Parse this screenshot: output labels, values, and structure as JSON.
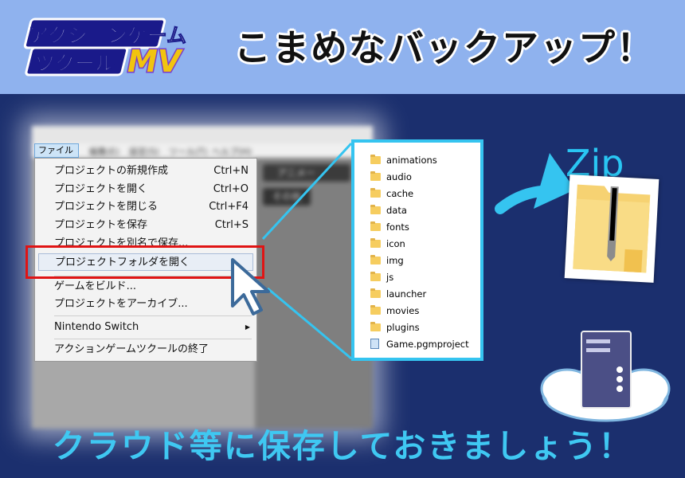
{
  "header": {
    "logo_line1": "アクションゲーム",
    "logo_line2": "ツクール",
    "logo_mv": "MV",
    "headline": "こまめなバックアップ！"
  },
  "app": {
    "menubar": [
      "ファイル(F)",
      "編集(E)",
      "設定(S)",
      "ツール(T)",
      "ヘルプ(H)"
    ],
    "canvas_button1": "アニメー",
    "canvas_button2": "その他"
  },
  "file_menu": {
    "items": [
      {
        "label": "プロジェクトの新規作成",
        "shortcut": "Ctrl+N"
      },
      {
        "label": "プロジェクトを開く",
        "shortcut": "Ctrl+O"
      },
      {
        "label": "プロジェクトを閉じる",
        "shortcut": "Ctrl+F4"
      },
      {
        "label": "プロジェクトを保存",
        "shortcut": "Ctrl+S"
      },
      {
        "label": "プロジェクトを別名で保存...",
        "shortcut": ""
      },
      {
        "label": "プロジェクトフォルダを開く",
        "shortcut": ""
      },
      {
        "label": "ゲームをビルド...",
        "shortcut": ""
      },
      {
        "label": "プロジェクトをアーカイブ...",
        "shortcut": ""
      },
      {
        "label": "Nintendo Switch",
        "shortcut": ""
      },
      {
        "label": "アクションゲームツクールの終了",
        "shortcut": ""
      }
    ],
    "highlighted_index": 5
  },
  "explorer": {
    "items": [
      "animations",
      "audio",
      "cache",
      "data",
      "fonts",
      "icon",
      "img",
      "js",
      "launcher",
      "movies",
      "plugins",
      "Game.pgmproject"
    ]
  },
  "zip": {
    "label": "Zip"
  },
  "footer": {
    "text": "クラウド等に保存しておきましょう！"
  },
  "colors": {
    "header_bg": "#8fb2ee",
    "main_bg": "#1b2f6e",
    "accent": "#35c4f0",
    "highlight_red": "#e01414"
  }
}
